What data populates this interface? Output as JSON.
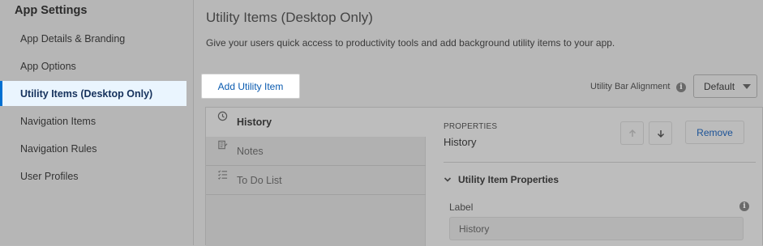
{
  "sidebar": {
    "title": "App Settings",
    "items": [
      {
        "label": "App Details & Branding"
      },
      {
        "label": "App Options"
      },
      {
        "label": "Utility Items (Desktop Only)"
      },
      {
        "label": "Navigation Items"
      },
      {
        "label": "Navigation Rules"
      },
      {
        "label": "User Profiles"
      }
    ],
    "active_index": 2
  },
  "main": {
    "title": "Utility Items (Desktop Only)",
    "description": "Give your users quick access to productivity tools and add background utility items to your app.",
    "add_button": "Add Utility Item",
    "alignment": {
      "label": "Utility Bar Alignment",
      "value": "Default"
    },
    "utility_items": [
      {
        "label": "History",
        "icon": "clock-icon"
      },
      {
        "label": "Notes",
        "icon": "notes-icon"
      },
      {
        "label": "To Do List",
        "icon": "checklist-icon"
      }
    ],
    "properties": {
      "header": "PROPERTIES",
      "name": "History",
      "remove_label": "Remove",
      "section_title": "Utility Item Properties",
      "field_label": "Label",
      "field_value": "History"
    }
  }
}
